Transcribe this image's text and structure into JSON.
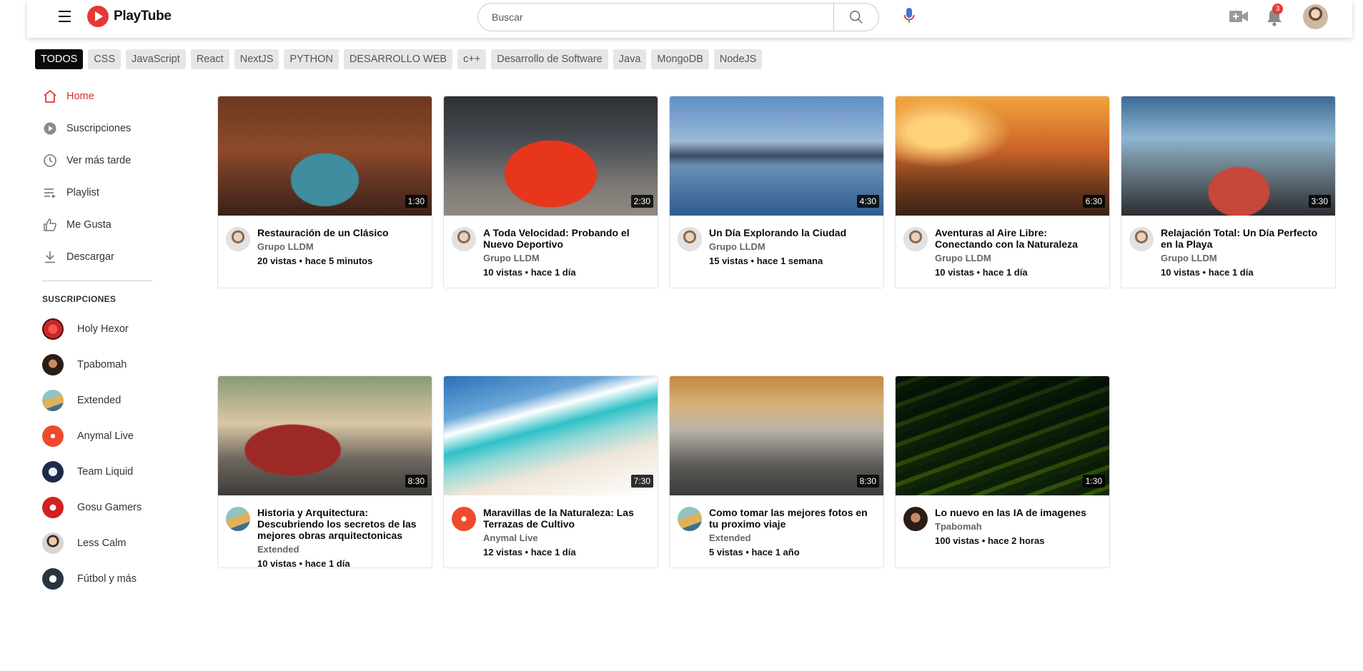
{
  "app": {
    "name": "PlayTube"
  },
  "search": {
    "placeholder": "Buscar"
  },
  "notifications": {
    "count": "3"
  },
  "chips": [
    "TODOS",
    "CSS",
    "JavaScript",
    "React",
    "NextJS",
    "PYTHON",
    "DESARROLLO WEB",
    "c++",
    "Desarrollo de Software",
    "Java",
    "MongoDB",
    "NodeJS"
  ],
  "sidebar": {
    "nav": [
      {
        "label": "Home",
        "icon": "home-icon"
      },
      {
        "label": "Suscripciones",
        "icon": "subscriptions-icon"
      },
      {
        "label": "Ver más tarde",
        "icon": "clock-icon"
      },
      {
        "label": "Playlist",
        "icon": "playlist-icon"
      },
      {
        "label": "Me Gusta",
        "icon": "thumbs-up-icon"
      },
      {
        "label": "Descargar",
        "icon": "download-icon"
      }
    ],
    "subs_heading": "SUSCRIPCIONES",
    "subscriptions": [
      "Holy Hexor",
      "Tpabomah",
      "Extended",
      "Anymal Live",
      "Team Liquid",
      "Gosu Gamers",
      "Less Calm",
      "Fútbol y más"
    ]
  },
  "videos": [
    {
      "title": "Restauración de un Clásico",
      "channel": "Grupo LLDM",
      "stats": "20 vistas • hace 5 minutos",
      "duration": "1:30"
    },
    {
      "title": "A Toda Velocidad: Probando el Nuevo Deportivo",
      "channel": "Grupo LLDM",
      "stats": "10 vistas • hace 1 día",
      "duration": "2:30"
    },
    {
      "title": "Un Día Explorando la Ciudad",
      "channel": "Grupo LLDM",
      "stats": "15 vistas • hace 1 semana",
      "duration": "4:30"
    },
    {
      "title": "Aventuras al Aire Libre: Conectando con la Naturaleza",
      "channel": "Grupo LLDM",
      "stats": "10 vistas • hace 1 día",
      "duration": "6:30"
    },
    {
      "title": "Relajación Total: Un Día Perfecto en la Playa",
      "channel": "Grupo LLDM",
      "stats": "10 vistas • hace 1 día",
      "duration": "3:30"
    },
    {
      "title": "Historia y Arquitectura: Descubriendo los secretos de las mejores obras arquitectonicas",
      "channel": "Extended",
      "stats": "10 vistas • hace 1 día",
      "duration": "8:30"
    },
    {
      "title": "Maravillas de la Naturaleza: Las Terrazas de Cultivo",
      "channel": "Anymal Live",
      "stats": "12 vistas • hace 1 día",
      "duration": "7:30"
    },
    {
      "title": "Como tomar las mejores fotos en tu proximo viaje",
      "channel": "Extended",
      "stats": "5 vistas • hace 1 año",
      "duration": "8:30"
    },
    {
      "title": "Lo nuevo en las IA de imagenes",
      "channel": "Tpabomah",
      "stats": "100 vistas • hace 2 horas",
      "duration": "1:30"
    }
  ],
  "colors": {
    "accent": "#e53935",
    "active_chip": "#0a0a0a",
    "chip_bg": "#e6e6e6"
  }
}
